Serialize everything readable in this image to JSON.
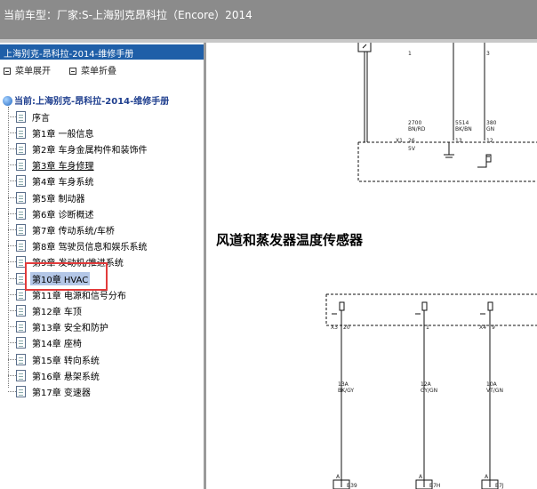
{
  "top_bar": {
    "vehicle_label": "当前车型：",
    "vehicle_value": "厂家:S-上海别克昂科拉（Encore）2014"
  },
  "left_panel": {
    "header": "上海别克-昂科拉-2014-维修手册",
    "expand_label": "菜单展开",
    "collapse_label": "菜单折叠",
    "root_label": "当前:上海别克-昂科拉-2014-维修手册",
    "items": [
      "序言",
      "第1章 一般信息",
      "第2章 车身金属构件和装饰件",
      "第3章 车身修理",
      "第4章 车身系统",
      "第5章 制动器",
      "第6章 诊断概述",
      "第7章 传动系统/车桥",
      "第8章 驾驶员信息和娱乐系统",
      "第9章 发动机/推进系统",
      "第10章 HVAC",
      "第11章 电源和信号分布",
      "第12章 车顶",
      "第13章 安全和防护",
      "第14章 座椅",
      "第15章 转向系统",
      "第16章 悬架系统",
      "第17章 变速器"
    ],
    "selected_index": 10,
    "underlined_index": 3
  },
  "diagram": {
    "section_title": "风道和蒸发器温度传感器",
    "upper_wires": [
      {
        "pin": "1",
        "num": "2700",
        "color": "BN/RD",
        "conn": "X1",
        "cpin": "26",
        "sig": "5V"
      },
      {
        "pin": "",
        "num": "5514",
        "color": "BK/BN",
        "conn": "",
        "cpin": "13",
        "sig": ""
      },
      {
        "pin": "3",
        "num": "380",
        "color": "GN",
        "conn": "",
        "cpin": "12",
        "sig": ""
      }
    ],
    "lower_wires": [
      {
        "conn": "X3",
        "cpin": "20",
        "num": "13A",
        "color": "BK/GY",
        "bottom": "A",
        "bpin": "B39"
      },
      {
        "conn": "",
        "cpin": "1",
        "num": "12A",
        "color": "GY/GN",
        "bottom": "A",
        "bpin": "B7H"
      },
      {
        "conn": "X4",
        "cpin": "9",
        "num": "10A",
        "color": "VT/GN",
        "bottom": "A",
        "bpin": "B7J"
      }
    ]
  }
}
